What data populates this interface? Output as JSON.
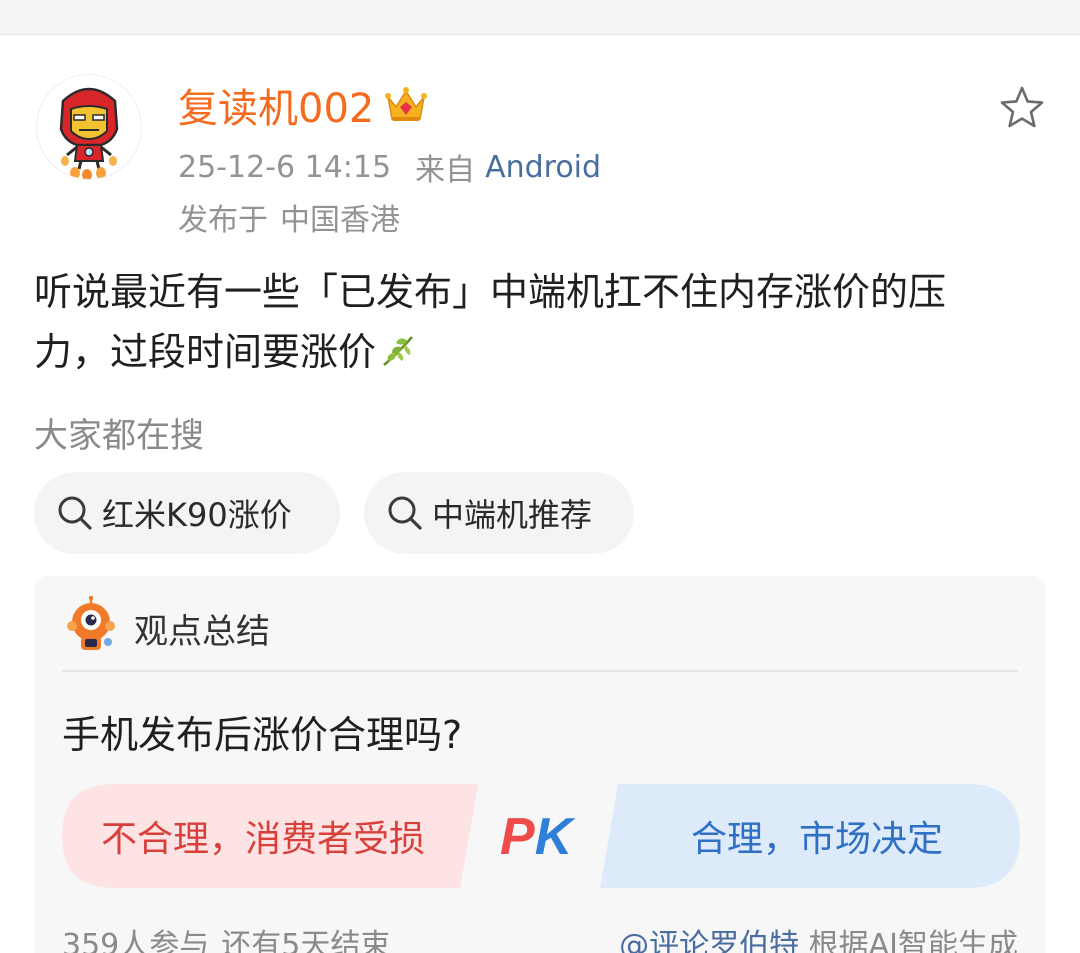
{
  "post": {
    "username": "复读机002",
    "timestamp": "25-12-6 14:15",
    "source_label": "来自",
    "source_app": "Android",
    "location_label": "发布于",
    "location_value": "中国香港",
    "text_line1": "听说最近有一些「已发布」中端机扛不住内存涨价的压",
    "text_line2": "力，过段时间要涨价",
    "icons": {
      "avatar": "iron-man-avatar",
      "badge": "crown-icon",
      "favorite": "star-icon",
      "emoji": "leaf-emoji-icon"
    }
  },
  "search": {
    "heading": "大家都在搜",
    "chips": [
      {
        "label": "红米K90涨价",
        "icon": "search-icon"
      },
      {
        "label": "中端机推荐",
        "icon": "search-icon"
      }
    ]
  },
  "summary": {
    "title": "观点总结",
    "question": "手机发布后涨价合理吗?",
    "option_left": "不合理，消费者受损",
    "option_right": "合理，市场决定",
    "pk_text": "PK",
    "participants": "359人参与",
    "time_left": "还有5天结束",
    "credit_mention": "@评论罗伯特",
    "credit_text": " 根据AI智能生成"
  },
  "colors": {
    "username": "#f46b1f",
    "link": "#4a6da0",
    "oppose": "#d8403b",
    "oppose_bg": "#fde3e3",
    "support": "#2f6fc4",
    "support_bg": "#ddeafa"
  }
}
